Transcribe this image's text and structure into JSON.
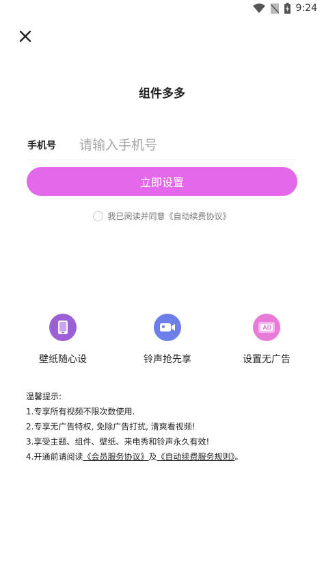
{
  "status_bar": {
    "time": "9:24"
  },
  "header": {
    "title": "组件多多"
  },
  "phone": {
    "label": "手机号",
    "placeholder": "请输入手机号",
    "value": ""
  },
  "actions": {
    "primary_label": "立即设置"
  },
  "agreement": {
    "text": "我已阅读并同意",
    "link": "《自动续费协议》"
  },
  "features": [
    {
      "label": "壁纸随心设",
      "icon": "phone-icon"
    },
    {
      "label": "铃声抢先享",
      "icon": "video-camera-icon"
    },
    {
      "label": "设置无广告",
      "icon": "ad-icon"
    }
  ],
  "tips": {
    "title": "温馨提示:",
    "line1": "1.专享所有视频不限次数使用.",
    "line2": "2.专享无广告特权, 免除广告打扰, 清爽看视频!",
    "line3": "3.享受主题、组件、壁纸、来电秀和铃声永久有效!",
    "line4_prefix": "4.开通前请阅读",
    "link_member": "《会员服务协议》",
    "line4_and": "及",
    "link_renew": "《自动续费服务规则》",
    "line4_suffix": "。"
  },
  "colors": {
    "accent": "#e468ea",
    "feature1": "#9b5fd6",
    "feature2": "#6c7ee9",
    "feature3": "#e87bd8"
  }
}
